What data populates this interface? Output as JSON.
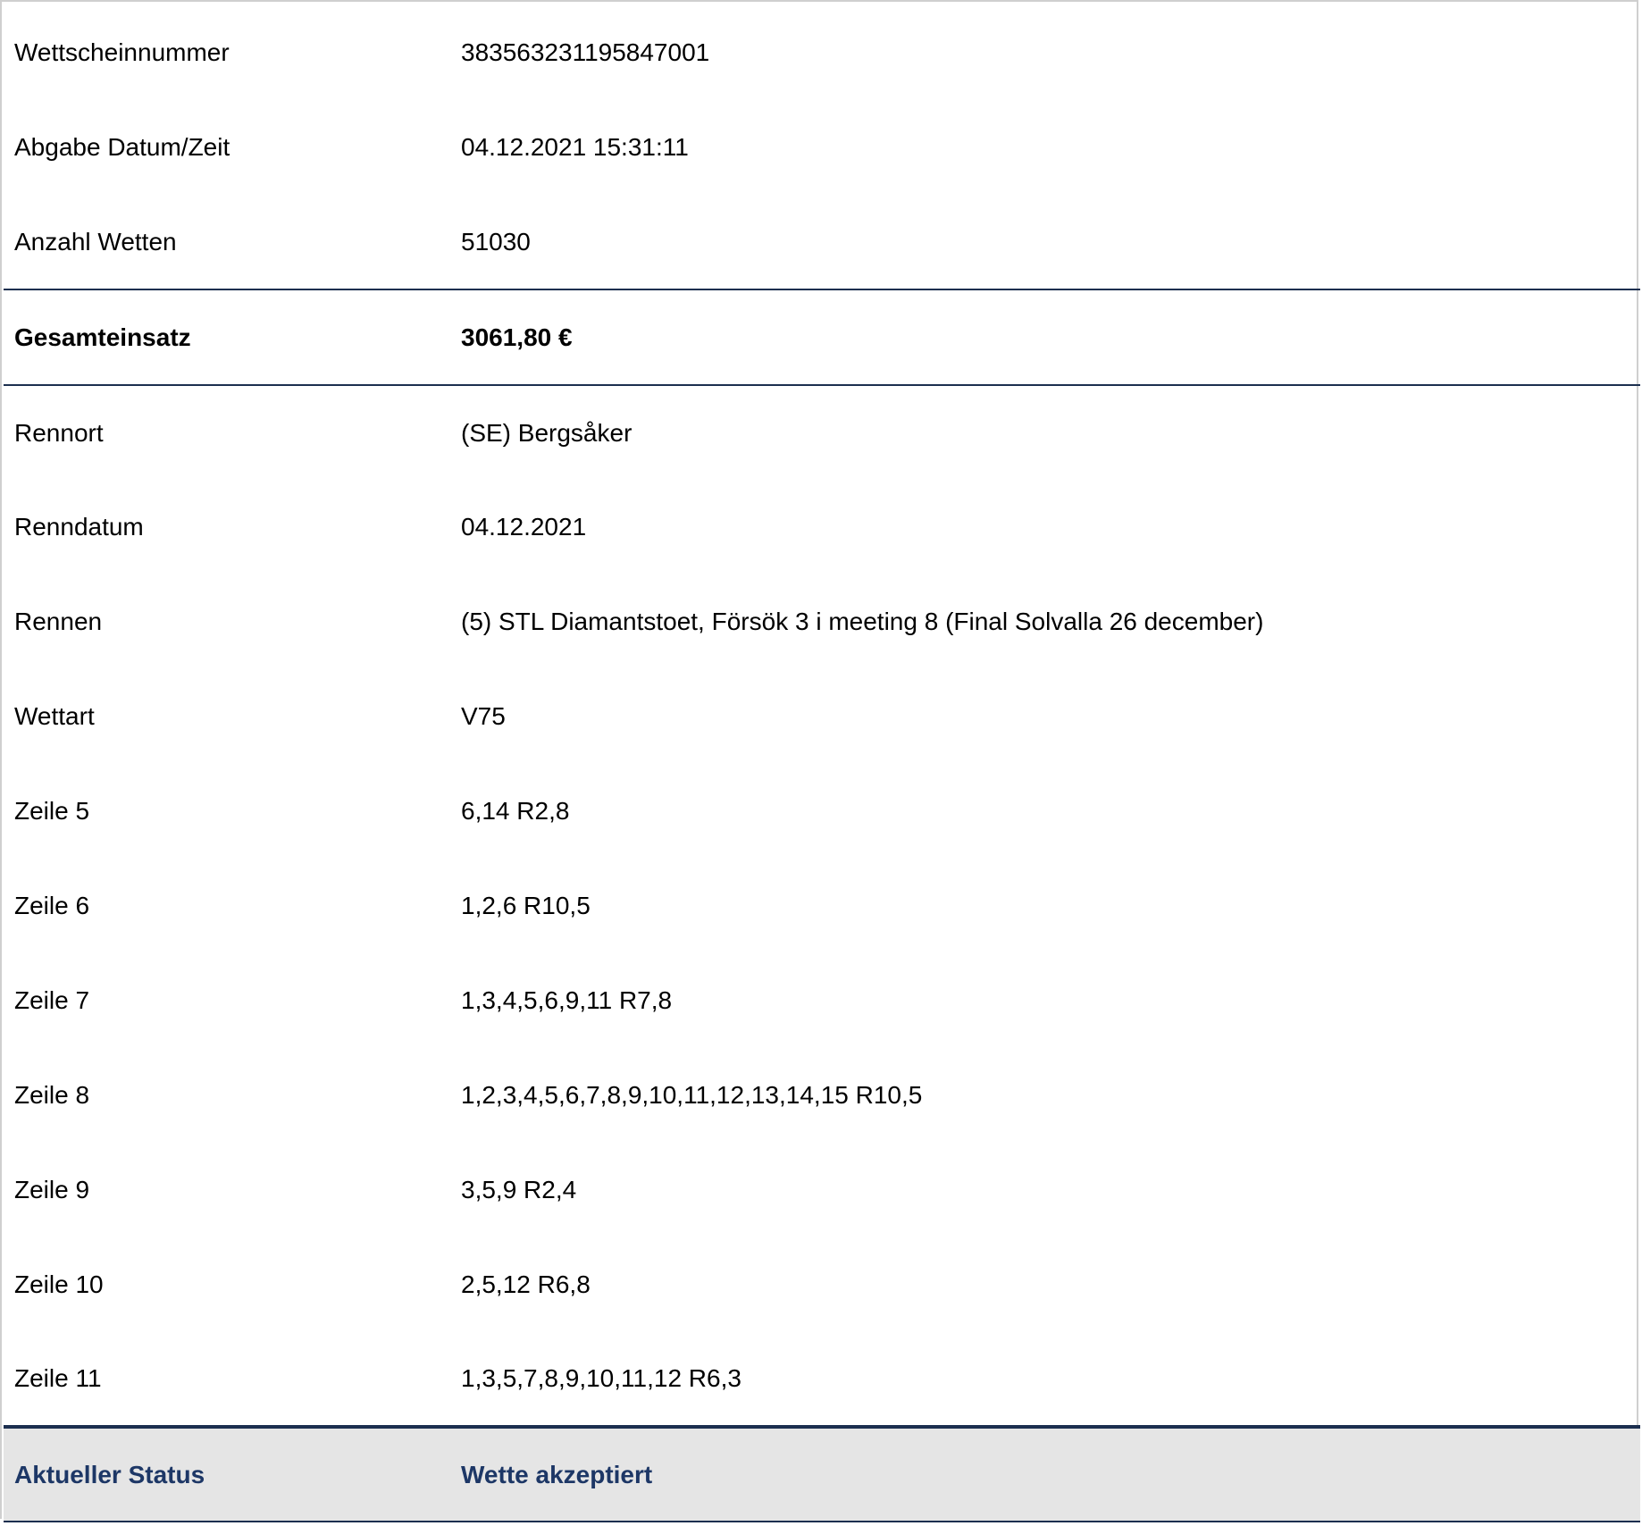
{
  "ticket": {
    "rows_top": [
      {
        "label": "Wettscheinnummer",
        "value": "383563231195847001"
      },
      {
        "label": "Abgabe Datum/Zeit",
        "value": "04.12.2021 15:31:11"
      },
      {
        "label": "Anzahl Wetten",
        "value": "51030"
      }
    ],
    "total": {
      "label": "Gesamteinsatz",
      "value": "3061,80 €"
    },
    "rows_detail": [
      {
        "label": "Rennort",
        "value": "(SE) Bergsåker"
      },
      {
        "label": "Renndatum",
        "value": "04.12.2021"
      },
      {
        "label": "Rennen",
        "value": "(5) STL Diamantstoet, Försök 3 i meeting 8 (Final Solvalla 26 december)"
      },
      {
        "label": "Wettart",
        "value": "V75"
      },
      {
        "label": "Zeile 5",
        "value": "6,14 R2,8"
      },
      {
        "label": "Zeile 6",
        "value": "1,2,6 R10,5"
      },
      {
        "label": "Zeile 7",
        "value": "1,3,4,5,6,9,11 R7,8"
      },
      {
        "label": "Zeile 8",
        "value": "1,2,3,4,5,6,7,8,9,10,11,12,13,14,15 R10,5"
      },
      {
        "label": "Zeile 9",
        "value": "3,5,9 R2,4"
      },
      {
        "label": "Zeile 10",
        "value": "2,5,12 R6,8"
      },
      {
        "label": "Zeile 11",
        "value": "1,3,5,7,8,9,10,11,12 R6,3"
      }
    ],
    "status": {
      "label": "Aktueller Status",
      "value": "Wette akzeptiert"
    }
  },
  "colors": {
    "divider": "#1c2f4f",
    "status_background": "#e5e5e5",
    "status_text": "#1d3766",
    "frame": "#cfcfcf"
  }
}
